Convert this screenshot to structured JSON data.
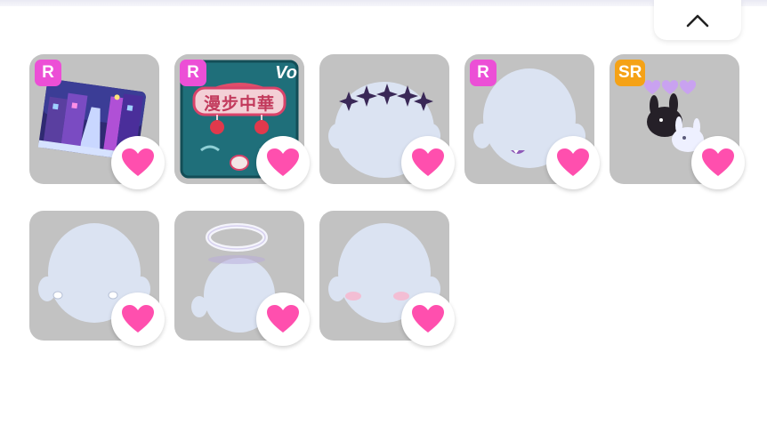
{
  "header": {
    "collapse_icon": "chevron-up-icon"
  },
  "colors": {
    "badge_r": "#ec4fd6",
    "badge_sr": "#f5a216",
    "heart": "#ff4fae",
    "tile_bg": "#c2c2c2"
  },
  "items": [
    {
      "id": "city-night-card",
      "badge": "R",
      "favorited": true,
      "icon": "city-street-art-icon"
    },
    {
      "id": "chinatown-poster",
      "badge": "R",
      "poster_text": "漫步中華",
      "extra_badge": "Vo",
      "favorited": true,
      "icon": "chinatown-poster-icon"
    },
    {
      "id": "dark-crown",
      "badge": "",
      "favorited": true,
      "icon": "dark-star-crown-icon"
    },
    {
      "id": "fang-mouth",
      "badge": "R",
      "favorited": true,
      "icon": "fang-mouth-icon"
    },
    {
      "id": "bunny-pets",
      "badge": "SR",
      "favorited": true,
      "icon": "bunny-pets-icon"
    },
    {
      "id": "small-eyes",
      "badge": "",
      "favorited": true,
      "icon": "small-eyes-icon"
    },
    {
      "id": "halo",
      "badge": "",
      "favorited": true,
      "icon": "halo-icon"
    },
    {
      "id": "blush",
      "badge": "",
      "favorited": true,
      "icon": "blush-cheeks-icon"
    }
  ]
}
